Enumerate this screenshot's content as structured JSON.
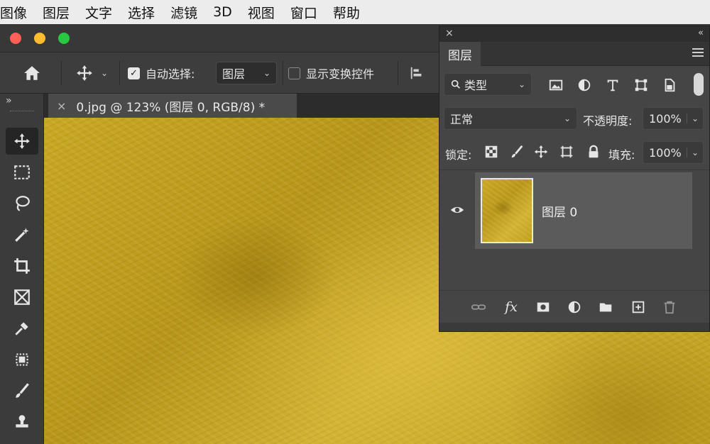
{
  "menubar": {
    "items": [
      "图像",
      "图层",
      "文字",
      "选择",
      "滤镜",
      "3D",
      "视图",
      "窗口",
      "帮助"
    ]
  },
  "options_bar": {
    "home_icon": "home-icon",
    "move_tool_icon": "move-icon",
    "auto_select": {
      "label": "自动选择:",
      "checked": true
    },
    "auto_select_target": {
      "value": "图层"
    },
    "show_transform": {
      "label": "显示变换控件",
      "checked": false
    },
    "align_icon": "align-left-icon"
  },
  "document": {
    "tab_title": "0.jpg @ 123% (图层 0, RGB/8) *",
    "close_glyph": "×"
  },
  "toolbar": {
    "collapse_glyph": "»",
    "tools": [
      {
        "name": "move-tool",
        "icon": "move-icon",
        "active": true
      },
      {
        "name": "marquee-tool",
        "icon": "marquee-icon"
      },
      {
        "name": "lasso-tool",
        "icon": "lasso-icon"
      },
      {
        "name": "magic-wand-tool",
        "icon": "magic-wand-icon"
      },
      {
        "name": "crop-tool",
        "icon": "crop-icon"
      },
      {
        "name": "frame-tool",
        "icon": "frame-icon"
      },
      {
        "name": "eyedropper-tool",
        "icon": "eyedropper-icon"
      },
      {
        "name": "healing-tool",
        "icon": "patch-icon"
      },
      {
        "name": "brush-tool",
        "icon": "brush-icon"
      },
      {
        "name": "stamp-tool",
        "icon": "stamp-icon"
      }
    ]
  },
  "layers_panel": {
    "close_glyph": "×",
    "collapse_glyph": "«",
    "tab_label": "图层",
    "filter": {
      "value": "类型"
    },
    "blend_mode": {
      "value": "正常"
    },
    "opacity": {
      "label": "不透明度:",
      "value": "100%"
    },
    "lock_label": "锁定:",
    "fill": {
      "label": "填充:",
      "value": "100%"
    },
    "layers": [
      {
        "name": "图层 0",
        "visible": true
      }
    ],
    "bottom_icons": [
      "link-icon",
      "fx-icon",
      "mask-icon",
      "adjustment-icon",
      "folder-icon",
      "new-layer-icon",
      "trash-icon"
    ],
    "fx_label": "fx"
  },
  "colors": {
    "accent_gold": "#c9a825",
    "panel_bg": "#454545",
    "menubar_bg": "#ececec"
  }
}
